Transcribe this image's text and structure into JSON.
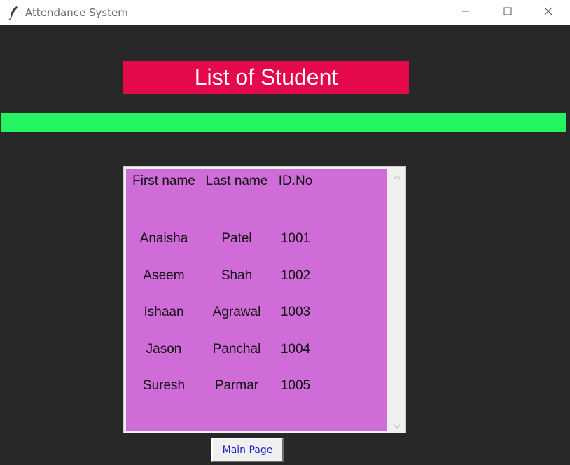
{
  "window": {
    "title": "Attendance System"
  },
  "heading": {
    "text": "List of Student"
  },
  "list": {
    "headers": [
      "First name",
      "Last name",
      "ID.No"
    ],
    "rows": [
      [
        "Anaisha",
        "Patel",
        "1001"
      ],
      [
        "Aseem",
        "Shah",
        "1002"
      ],
      [
        "Ishaan",
        "Agrawal",
        "1003"
      ],
      [
        "Jason",
        "Panchal",
        "1004"
      ],
      [
        "Suresh",
        "Parmar",
        "1005"
      ]
    ]
  },
  "button": {
    "main_page_label": "Main Page"
  },
  "colors": {
    "background": "#282828",
    "heading_bg": "#e4094b",
    "divider_bar": "#22f55f",
    "list_bg": "#d06cd8",
    "button_text": "#1d1dcf"
  },
  "icons": {
    "app": "feather-icon",
    "minimize": "minimize-icon",
    "maximize": "maximize-icon",
    "close": "close-icon"
  }
}
